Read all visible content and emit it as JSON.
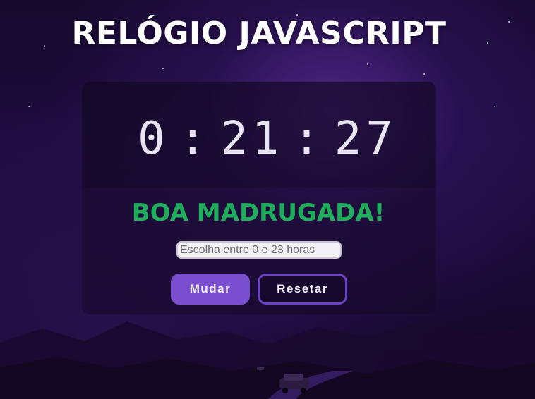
{
  "page": {
    "title": "RELÓGIO JAVASCRIPT"
  },
  "clock": {
    "hours": "0",
    "minutes": "21",
    "seconds": "27",
    "separator": ":"
  },
  "greeting": {
    "text": "BOA MADRUGADA!",
    "color": "#1fae5b"
  },
  "hour_input": {
    "placeholder": "Escolha entre 0 e 23 horas",
    "value": ""
  },
  "buttons": {
    "change_label": "Mudar",
    "reset_label": "Resetar",
    "accent": "#7a4fcf"
  },
  "theme": {
    "background": "#1d0c3c",
    "panel": "#160a28"
  }
}
